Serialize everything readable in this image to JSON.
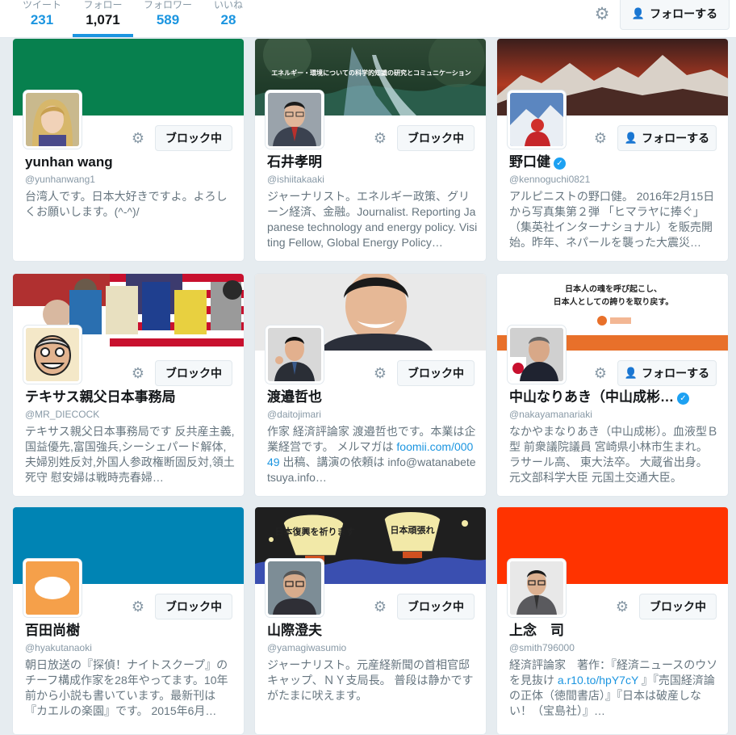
{
  "stats": [
    {
      "label": "ツイート",
      "value": "231"
    },
    {
      "label": "フォロー",
      "value": "1,071"
    },
    {
      "label": "フォロワー",
      "value": "589"
    },
    {
      "label": "いいね",
      "value": "28"
    }
  ],
  "header": {
    "follow_label": "フォローする"
  },
  "banner_texts": {
    "ishii": "エネルギー・環境についての科学的知識の研究とコミュニケーション",
    "nakayama_line1": "日本人の魂を呼び起こし、",
    "nakayama_line2": "日本人としての誇りを取り戻す。",
    "lantern_left": "日本復興を祈ります",
    "lantern_right": "日本頑張れ"
  },
  "cards": [
    {
      "name": "yunhan wang",
      "handle": "@yunhanwang1",
      "button": "ブロック中",
      "bio": "台湾人です。日本大好きですよ。よろしくお願いします。(^-^)/",
      "banner_color": "#07804e"
    },
    {
      "name": "石井孝明",
      "handle": "@ishiitakaaki",
      "button": "ブロック中",
      "bio": "ジャーナリスト。エネルギー政策、グリーン経済、金融。Journalist. Reporting Japanese technology and energy policy. Visiting Fellow, Global Energy Policy…"
    },
    {
      "name": "野口健",
      "handle": "@kennoguchi0821",
      "button": "フォローする",
      "bio": "アルピニストの野口健。 2016年2月15日から写真集第２弾 「ヒマラヤに捧ぐ」（集英社インターナショナル）を販売開始。昨年、ネパールを襲った大震災…"
    },
    {
      "name": "テキサス親父日本事務局",
      "handle": "@MR_DIECOCK",
      "button": "ブロック中",
      "bio": "テキサス親父日本事務局です 反共産主義,国益優先,富国強兵,シーシェパード解体,夫婦別姓反対,外国人参政権断固反対,領土死守 慰安婦は戦時売春婦…"
    },
    {
      "name": "渡邉哲也",
      "handle": "@daitojimari",
      "button": "ブロック中",
      "bio_pre": "作家 経済評論家 渡邉哲也です。本業は企業経営です。 メルマガは ",
      "bio_link": "foomii.com/00049",
      "bio_post": " 出稿、講演の依頼は info@watanabetetsuya.info…"
    },
    {
      "name": "中山なりあき（中山成彬…",
      "handle": "@nakayamanariaki",
      "button": "フォローする",
      "bio": "なかやまなりあき（中山成彬）。血液型Ｂ型 前衆議院議員 宮崎県小林市生まれ。 ラサール高、 東大法卒。 大蔵省出身。 元文部科学大臣 元国土交通大臣。"
    },
    {
      "name": "百田尚樹",
      "handle": "@hyakutanaoki",
      "button": "ブロック中",
      "bio": "朝日放送の『探偵！ナイトスクープ』のチーフ構成作家を28年やってます。10年前から小説も書いています。最新刊は『カエルの楽園』です。 2015年6月…",
      "banner_color": "#0084b4"
    },
    {
      "name": "山際澄夫",
      "handle": "@yamagiwasumio",
      "button": "ブロック中",
      "bio": "ジャーナリスト。元産経新聞の首相官邸キャップ、ＮＹ支局長。 普段は静かですがたまに吠えます。"
    },
    {
      "name": "上念　司",
      "handle": "@smith796000",
      "button": "ブロック中",
      "bio_pre": "経済評論家　著作：『経済ニュースのウソを見抜け ",
      "bio_link": "a.r10.to/hpY7cY",
      "bio_post": " 』『売国経済論の正体（徳間書店）』『日本は破産しない！（宝島社）』…",
      "banner_color": "#ff3300"
    }
  ]
}
